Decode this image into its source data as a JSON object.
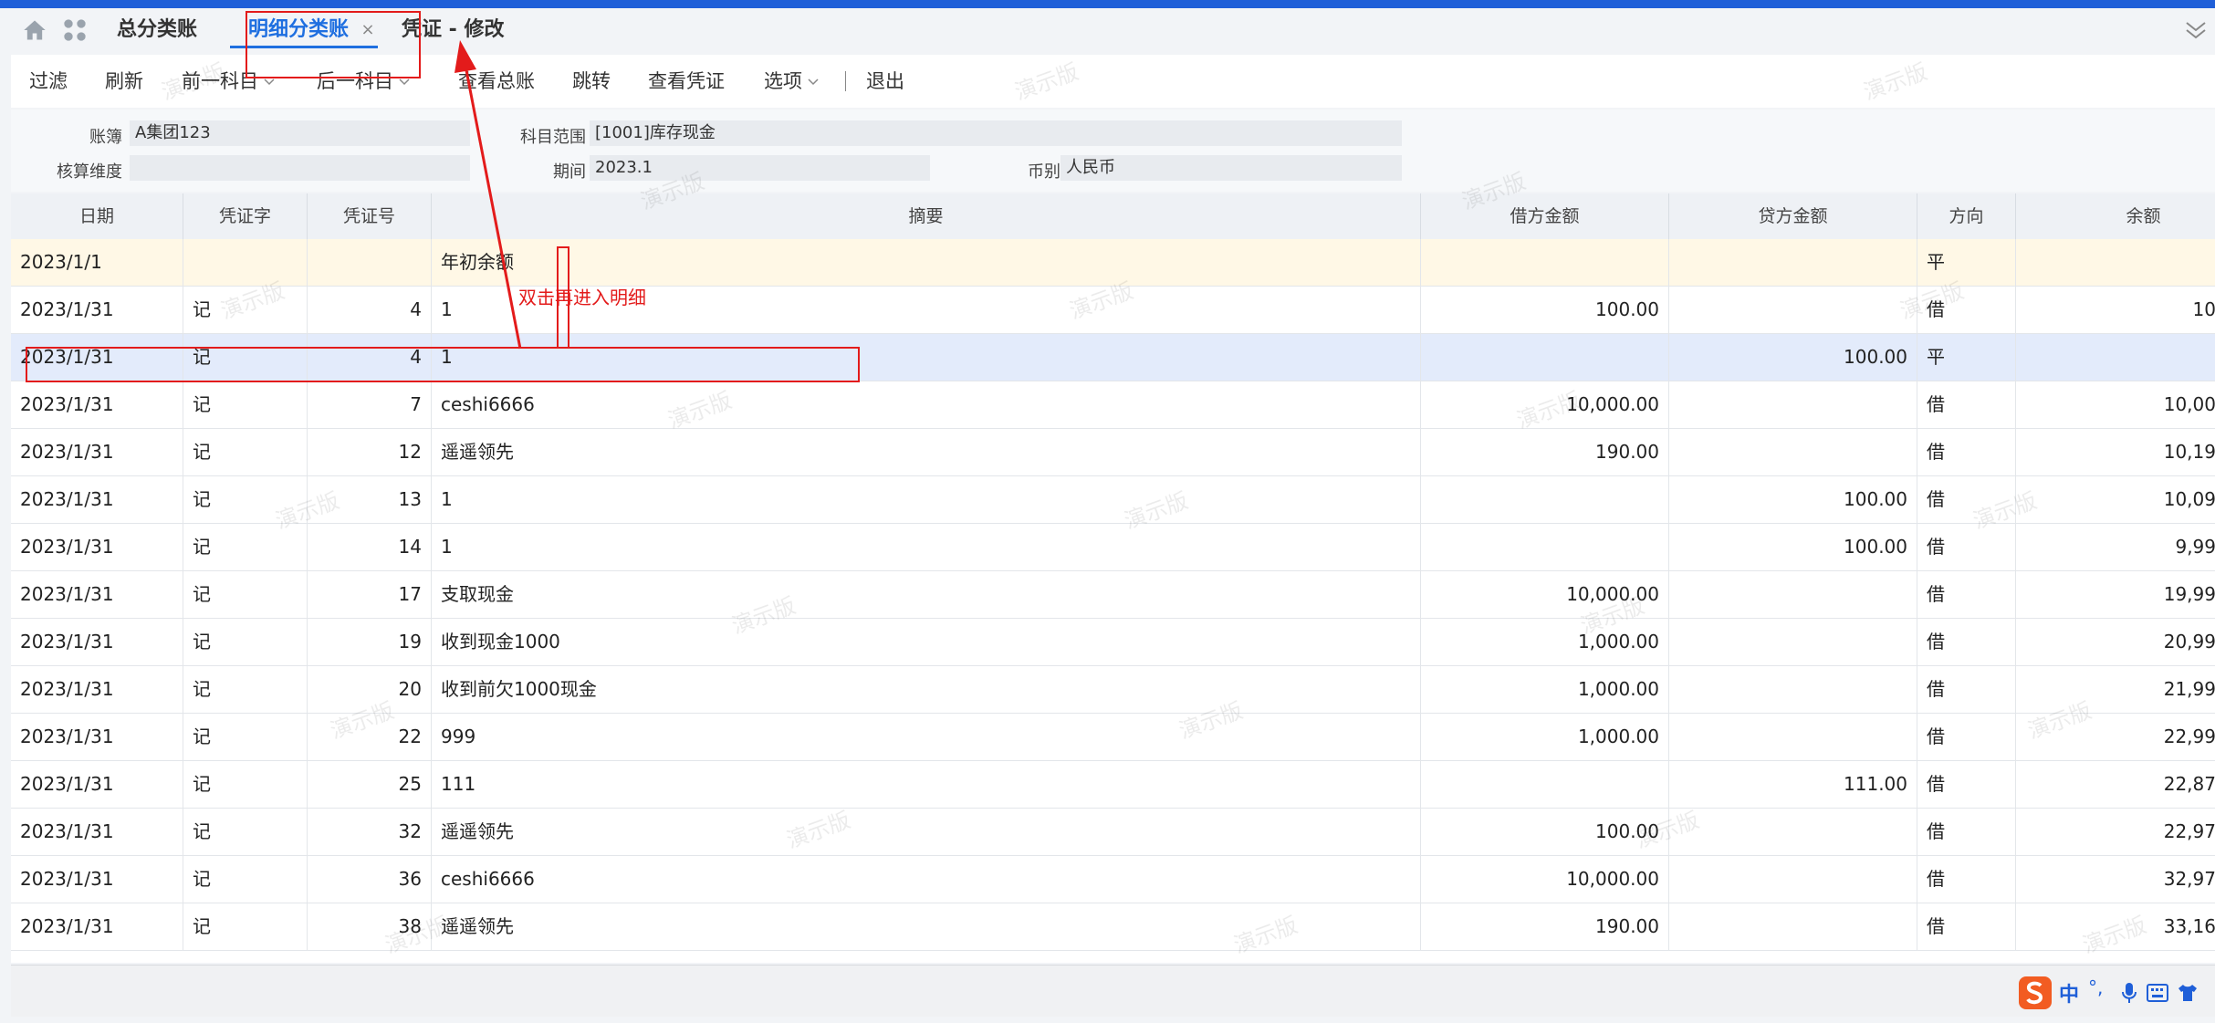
{
  "tabs": [
    {
      "label": "总分类账",
      "active": false
    },
    {
      "label": "明细分类账",
      "active": true
    },
    {
      "label": "凭证 - 修改",
      "active": false
    }
  ],
  "tab_close_glyph": "×",
  "toolbar": {
    "filter": "过滤",
    "refresh": "刷新",
    "prev_subject": "前一科目",
    "next_subject": "后一科目",
    "view_general_ledger": "查看总账",
    "jump": "跳转",
    "view_voucher": "查看凭证",
    "options": "选项",
    "exit": "退出"
  },
  "filter": {
    "ledger_label": "账簿",
    "ledger_value": "A集团123",
    "subject_range_label": "科目范围",
    "subject_range_value": "[1001]库存现金",
    "dimension_label": "核算维度",
    "dimension_value": "",
    "period_label": "期间",
    "period_value": "2023.1",
    "currency_label": "币别",
    "currency_value": "人民币"
  },
  "table": {
    "columns": [
      "日期",
      "凭证字",
      "凭证号",
      "摘要",
      "借方金额",
      "贷方金额",
      "方向",
      "余额"
    ],
    "rows": [
      {
        "date": "2023/1/1",
        "word": "",
        "no": "",
        "summary": "年初余额",
        "debit": "",
        "credit": "",
        "dir": "平",
        "balance": ""
      },
      {
        "date": "2023/1/31",
        "word": "记",
        "no": "4",
        "summary": "1",
        "debit": "100.00",
        "credit": "",
        "dir": "借",
        "balance": "10"
      },
      {
        "date": "2023/1/31",
        "word": "记",
        "no": "4",
        "summary": "1",
        "debit": "",
        "credit": "100.00",
        "dir": "平",
        "balance": ""
      },
      {
        "date": "2023/1/31",
        "word": "记",
        "no": "7",
        "summary": "ceshi6666",
        "debit": "10,000.00",
        "credit": "",
        "dir": "借",
        "balance": "10,00"
      },
      {
        "date": "2023/1/31",
        "word": "记",
        "no": "12",
        "summary": "遥遥领先",
        "debit": "190.00",
        "credit": "",
        "dir": "借",
        "balance": "10,19"
      },
      {
        "date": "2023/1/31",
        "word": "记",
        "no": "13",
        "summary": "1",
        "debit": "",
        "credit": "100.00",
        "dir": "借",
        "balance": "10,09"
      },
      {
        "date": "2023/1/31",
        "word": "记",
        "no": "14",
        "summary": "1",
        "debit": "",
        "credit": "100.00",
        "dir": "借",
        "balance": "9,99"
      },
      {
        "date": "2023/1/31",
        "word": "记",
        "no": "17",
        "summary": "支取现金",
        "debit": "10,000.00",
        "credit": "",
        "dir": "借",
        "balance": "19,99"
      },
      {
        "date": "2023/1/31",
        "word": "记",
        "no": "19",
        "summary": "收到现金1000",
        "debit": "1,000.00",
        "credit": "",
        "dir": "借",
        "balance": "20,99"
      },
      {
        "date": "2023/1/31",
        "word": "记",
        "no": "20",
        "summary": "收到前欠1000现金",
        "debit": "1,000.00",
        "credit": "",
        "dir": "借",
        "balance": "21,99"
      },
      {
        "date": "2023/1/31",
        "word": "记",
        "no": "22",
        "summary": "999",
        "debit": "1,000.00",
        "credit": "",
        "dir": "借",
        "balance": "22,99"
      },
      {
        "date": "2023/1/31",
        "word": "记",
        "no": "25",
        "summary": "111",
        "debit": "",
        "credit": "111.00",
        "dir": "借",
        "balance": "22,87"
      },
      {
        "date": "2023/1/31",
        "word": "记",
        "no": "32",
        "summary": "遥遥领先",
        "debit": "100.00",
        "credit": "",
        "dir": "借",
        "balance": "22,97"
      },
      {
        "date": "2023/1/31",
        "word": "记",
        "no": "36",
        "summary": "ceshi6666",
        "debit": "10,000.00",
        "credit": "",
        "dir": "借",
        "balance": "32,97"
      },
      {
        "date": "2023/1/31",
        "word": "记",
        "no": "38",
        "summary": "遥遥领先",
        "debit": "190.00",
        "credit": "",
        "dir": "借",
        "balance": "33,16"
      }
    ]
  },
  "annotation": {
    "text": "双击再进入明细",
    "color": "#e31b1b"
  },
  "watermark": "演示版",
  "ime": {
    "chinese": "中",
    "punct": "°,"
  },
  "colors": {
    "accent": "#1f6fe0",
    "selected_row": "#e3ebfb",
    "first_row": "#fff8e6",
    "annotation": "#e31b1b"
  }
}
